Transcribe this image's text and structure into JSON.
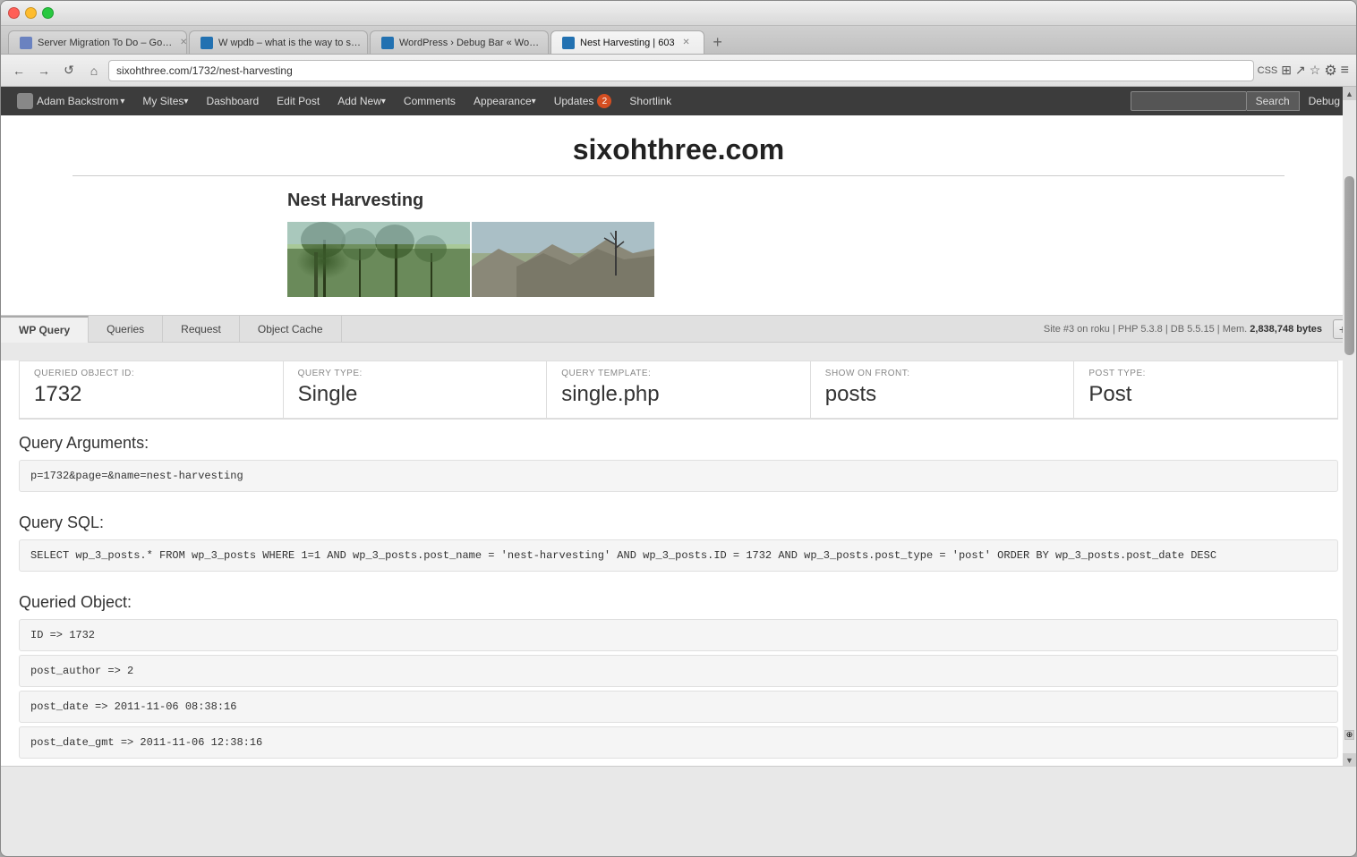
{
  "browser": {
    "tabs": [
      {
        "id": "tab1",
        "title": "Server Migration To Do – Go…",
        "active": false,
        "favicon": "page"
      },
      {
        "id": "tab2",
        "title": "W wpdb – what is the way to s…",
        "active": false,
        "favicon": "wp"
      },
      {
        "id": "tab3",
        "title": "WordPress › Debug Bar « Wo…",
        "active": false,
        "favicon": "wp"
      },
      {
        "id": "tab4",
        "title": "Nest Harvesting | 603",
        "active": true,
        "favicon": "wp"
      }
    ],
    "url": "sixohthree.com/1732/nest-harvesting",
    "nav_labels": {
      "css": "CSS",
      "back": "←",
      "forward": "→",
      "reload": "↺",
      "home": "⌂"
    }
  },
  "wp_admin_bar": {
    "user": "Adam Backstrom",
    "my_sites": "My Sites",
    "dashboard": "Dashboard",
    "edit_post": "Edit Post",
    "add_new": "Add New",
    "comments": "Comments",
    "appearance": "Appearance",
    "updates": "Updates",
    "updates_count": "2",
    "shortlink": "Shortlink",
    "search_placeholder": "",
    "search_button": "Search",
    "debug": "Debug"
  },
  "site": {
    "title": "sixohthree.com",
    "post_title": "Nest Harvesting"
  },
  "debug_bar": {
    "tabs": [
      {
        "id": "wp-query",
        "label": "WP Query",
        "active": true
      },
      {
        "id": "queries",
        "label": "Queries",
        "active": false
      },
      {
        "id": "request",
        "label": "Request",
        "active": false
      },
      {
        "id": "object-cache",
        "label": "Object Cache",
        "active": false
      }
    ],
    "meta": {
      "site": "Site #3 on roku",
      "php": "PHP 5.3.8",
      "db": "DB 5.5.15",
      "mem_label": "Mem.",
      "mem_value": "2,838,748 bytes"
    },
    "stats": [
      {
        "label": "QUERIED OBJECT ID:",
        "value": "1732"
      },
      {
        "label": "QUERY TYPE:",
        "value": "Single"
      },
      {
        "label": "QUERY TEMPLATE:",
        "value": "single.php"
      },
      {
        "label": "SHOW ON FRONT:",
        "value": "posts"
      },
      {
        "label": "POST TYPE:",
        "value": "Post"
      }
    ],
    "query_arguments": {
      "title": "Query Arguments:",
      "value": "p=1732&page=&name=nest-harvesting"
    },
    "query_sql": {
      "title": "Query SQL:",
      "value": "SELECT wp_3_posts.* FROM wp_3_posts WHERE 1=1 AND wp_3_posts.post_name = 'nest-harvesting' AND wp_3_posts.ID = 1732 AND wp_3_posts.post_type = 'post' ORDER BY wp_3_posts.post_date DESC"
    },
    "queried_object": {
      "title": "Queried Object:",
      "fields": [
        "ID => 1732",
        "post_author => 2",
        "post_date => 2011-11-06 08:38:16",
        "post_date_gmt => 2011-11-06 12:38:16"
      ]
    }
  }
}
